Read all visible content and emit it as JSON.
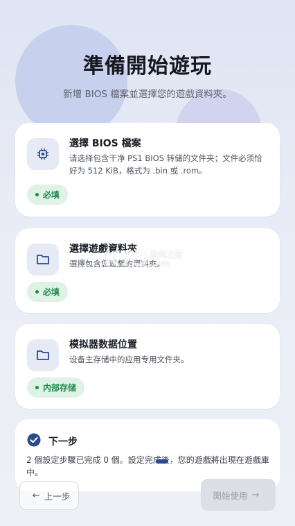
{
  "header": {
    "title": "準備開始遊玩",
    "subtitle": "新增 BIOS 檔案並選擇您的遊戲資料夾。"
  },
  "cards": [
    {
      "icon": "chip-icon",
      "title": "選擇 BIOS 檔案",
      "description": "请选择包含干净 PS1 BIOS 转储的文件夹；文件必须恰好为 512 KiB，格式为 .bin 或 .rom。",
      "badge": "必填"
    },
    {
      "icon": "folder-icon",
      "title": "選擇遊戲資料夾",
      "description": "選擇包含您遊戲的資料夾。",
      "badge": "必填"
    },
    {
      "icon": "folder-icon",
      "title": "模拟器数据位置",
      "description": "设备主存储中的应用专用文件夹。",
      "badge": "内部存储"
    }
  ],
  "next_step": {
    "title": "下一步",
    "description": "2 個設定步驟已完成 0 個。設定完成後，您的遊戲將出現在遊戲庫中。"
  },
  "footer": {
    "back_label": "上一步",
    "start_label": "開始使用"
  },
  "watermark": {
    "logo": "K73",
    "text_line1": "游戏之家",
    "text_line2": ".com"
  },
  "colors": {
    "accent": "#2a4b8c",
    "badge_green": "#1f8a4c",
    "badge_bg": "#dff2e6"
  }
}
